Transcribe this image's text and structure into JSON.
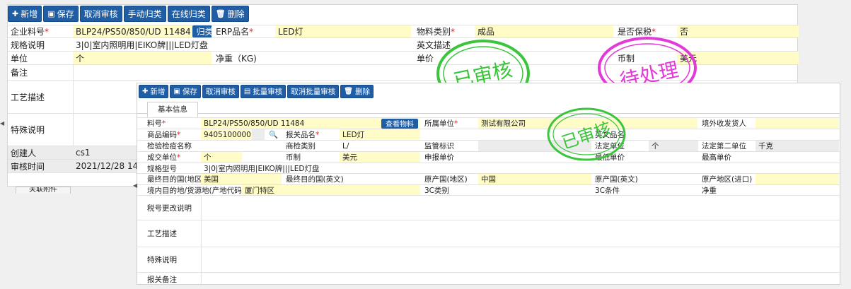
{
  "back": {
    "toolbar": [
      {
        "label": "新增",
        "icon": "plus-icon"
      },
      {
        "label": "保存",
        "icon": "floppy-icon"
      },
      {
        "label": "取消审核",
        "icon": ""
      },
      {
        "label": "手动归类",
        "icon": ""
      },
      {
        "label": "在线归类",
        "icon": ""
      },
      {
        "label": "删除",
        "icon": "trash-icon"
      }
    ],
    "labels": {
      "enterprise_part_no": "企业料号",
      "erp_name": "ERP品名",
      "material_category": "物料类别",
      "bonded": "是否保税",
      "spec": "规格说明",
      "english_desc": "英文描述",
      "unit": "单位",
      "net_weight": "净重（KG)",
      "unit_price": "单价",
      "currency": "币制",
      "remark": "备注",
      "process": "工艺描述",
      "special": "特殊说明",
      "creator": "创建人",
      "audit_time": "审核时间",
      "attach_tab": "关联附件"
    },
    "values": {
      "enterprise_part_no": "BLP24/PS50/850/UD 11484",
      "classify_btn": "归类查看",
      "erp_name": "LED灯",
      "material_category": "成品",
      "bonded": "否",
      "spec": "3|0|室内照明用|EIKO牌|||LED灯盘",
      "unit": "个",
      "currency": "美元",
      "creator": "cs1",
      "audit_time": "2021/12/28 14:56"
    },
    "stamps": {
      "approved": "已审核",
      "pending": "待处理"
    }
  },
  "front": {
    "toolbar": [
      {
        "label": "新增",
        "icon": "plus-icon"
      },
      {
        "label": "保存",
        "icon": "floppy-icon"
      },
      {
        "label": "取消审核",
        "icon": ""
      },
      {
        "label": "批量审核",
        "icon": "batch-icon"
      },
      {
        "label": "取消批量审核",
        "icon": ""
      },
      {
        "label": "删除",
        "icon": "trash-icon"
      }
    ],
    "tab": "基本信息",
    "labels": {
      "part_no": "料号",
      "owner_unit": "所属单位",
      "overseas_shipper": "境外收发货人",
      "commodity_code": "商品编码",
      "declared_name": "报关品名",
      "english_name": "英文品名",
      "inspection_name": "检验检疫名称",
      "inspection_category": "商检类别",
      "supervision_mark": "监管标识",
      "legal_unit": "法定单位",
      "legal_unit2": "法定第二单位",
      "deal_unit": "成交单位",
      "currency": "币制",
      "declared_price": "申报单价",
      "min_price": "最低单价",
      "max_price": "最高单价",
      "spec_model": "规格型号",
      "dest_country": "最终目的国(地区)",
      "dest_country_en": "最终目的国(英文)",
      "origin_country": "原产国(地区)",
      "origin_country_en": "原产国(英文)",
      "origin_region_import": "原产地区(进口)",
      "domestic_dest": "境内目的地/货源地(产地代码)",
      "ccc_category": "3C类别",
      "ccc_condition": "3C条件",
      "net_weight": "净重",
      "tax_change": "税号更改说明",
      "process": "工艺描述",
      "special": "特殊说明",
      "customs_remark": "报关备注"
    },
    "values": {
      "part_no": "BLP24/PS50/850/UD 11484",
      "view_material_btn": "查看物料",
      "owner_unit": "测试有限公司",
      "commodity_code": "9405100000",
      "declared_name": "LED灯",
      "inspection_category": "L/",
      "legal_unit": "个",
      "legal_unit2": "千克",
      "deal_unit": "个",
      "currency": "美元",
      "spec_model": "3|0|室内照明用|EIKO牌|||LED灯盘",
      "dest_country": "美国",
      "origin_country": "中国",
      "domestic_dest": "厦门特区"
    },
    "stamp": "已审核"
  },
  "colors": {
    "button": "#1f5da5",
    "required_field": "#fffcc8",
    "readonly_field": "#ececec",
    "required_mark": "#e0201c",
    "stamp_green": "#3bc53b",
    "stamp_magenta": "#e23ad8"
  }
}
